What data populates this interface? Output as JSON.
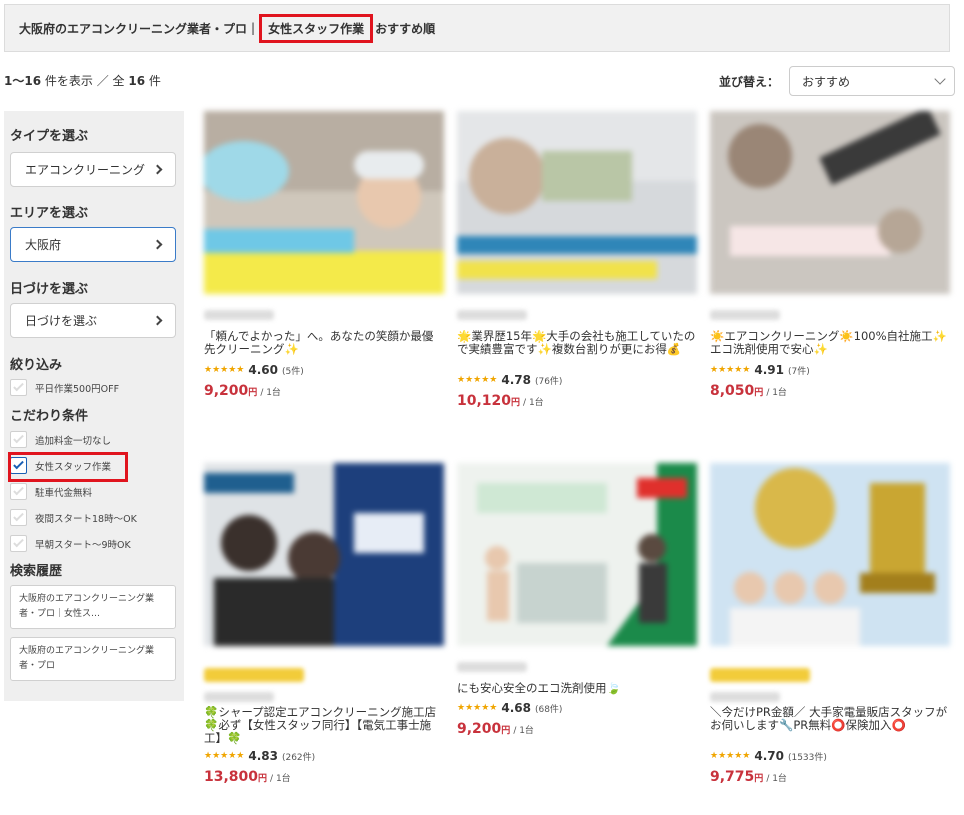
{
  "breadcrumb": {
    "parent": "大阪府のエアコンクリーニング業者・プロ",
    "separator": "|",
    "current": "女性スタッフ作業",
    "tail": "おすすめ順"
  },
  "results": {
    "range": "1〜16",
    "unit_label": "件を表示 ／ 全",
    "total": "16",
    "suffix": "件"
  },
  "sort": {
    "label": "並び替え：",
    "selected": "おすすめ"
  },
  "sidebar": {
    "type_heading": "タイプを選ぶ",
    "type_value": "エアコンクリーニング",
    "area_heading": "エリアを選ぶ",
    "area_value": "大阪府",
    "date_heading": "日づけを選ぶ",
    "date_value": "日づけを選ぶ",
    "filter_heading": "絞り込み",
    "filter_items": [
      {
        "label": "平日作業500円OFF",
        "checked": false
      }
    ],
    "conditions_heading": "こだわり条件",
    "condition_items": [
      {
        "label": "追加料金一切なし",
        "checked": false
      },
      {
        "label": "女性スタッフ作業",
        "checked": true
      },
      {
        "label": "駐車代金無料",
        "checked": false
      },
      {
        "label": "夜間スタート18時〜OK",
        "checked": false
      },
      {
        "label": "早朝スタート〜9時OK",
        "checked": false
      }
    ],
    "history_heading": "検索履歴",
    "history_items": [
      {
        "line1": "大阪府のエアコンクリーニング業",
        "line2": "者・プロ｜女性ス…"
      },
      {
        "line1": "大阪府のエアコンクリーニング業",
        "line2": "者・プロ"
      }
    ]
  },
  "listings": [
    {
      "title": "「頼んでよかった」へ。あなたの笑顔か最優先クリーニング✨",
      "stars": "★★★★★",
      "score": "4.60",
      "reviews": "(5件)",
      "price": "9,200",
      "price_unit": "円",
      "per": "/ 1台"
    },
    {
      "title": "🌟業界歴15年🌟大手の会社も施工していたので実績豊富です✨複数台割りが更にお得💰",
      "stars": "★★★★★",
      "score": "4.78",
      "reviews": "(76件)",
      "price": "10,120",
      "price_unit": "円",
      "per": "/ 1台"
    },
    {
      "title": "☀️エアコンクリーニング☀️100%自社施工✨エコ洗剤使用で安心✨",
      "stars": "★★★★★",
      "score": "4.91",
      "reviews": "(7件)",
      "price": "8,050",
      "price_unit": "円",
      "per": "/ 1台"
    },
    {
      "title": "🍀シャープ認定エアコンクリーニング施工店🍀必ず【女性スタッフ同行】【電気工事士施工】🍀",
      "stars": "★★★★★",
      "score": "4.83",
      "reviews": "(262件)",
      "price": "13,800",
      "price_unit": "円",
      "per": "/ 1台"
    },
    {
      "title": "にも安心安全のエコ洗剤使用🍃",
      "stars": "★★★★★",
      "score": "4.68",
      "reviews": "(68件)",
      "price": "9,200",
      "price_unit": "円",
      "per": "/ 1台"
    },
    {
      "title": "＼今だけPR金額／ 大手家電量販店スタッフがお伺いします🔧PR無料⭕保険加入⭕",
      "stars": "★★★★★",
      "score": "4.70",
      "reviews": "(1533件)",
      "price": "9,775",
      "price_unit": "円",
      "per": "/ 1台"
    }
  ]
}
